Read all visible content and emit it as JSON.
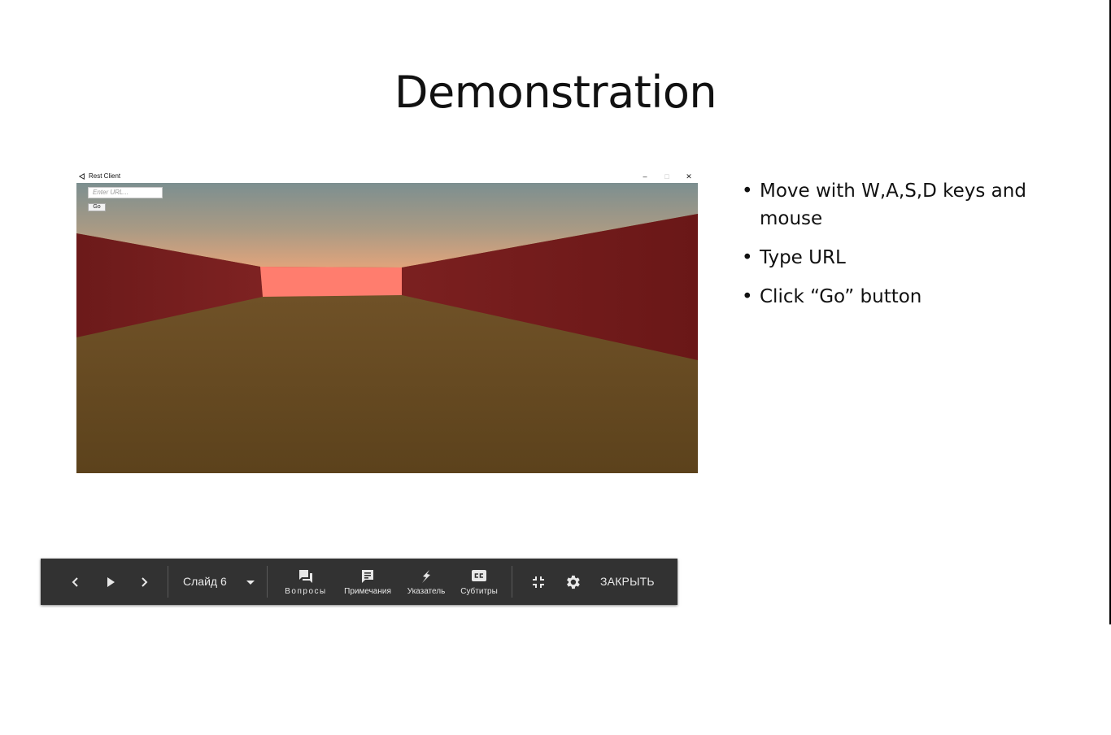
{
  "slide": {
    "title": "Demonstration",
    "bullets": [
      "Move with W,A,S,D keys and mouse",
      "Type URL",
      "Click “Go” button"
    ]
  },
  "embedded_app": {
    "window_title": "Rest Client",
    "url_input_placeholder": "Enter URL...",
    "go_button_label": "Go",
    "window_controls": {
      "minimize": "–",
      "maximize": "□",
      "close": "✕"
    },
    "scene_colors": {
      "sky_top": "#7d9191",
      "sky_horizon": "#d8a880",
      "wall": "#6e1a1a",
      "far_wall": "#ff7a6a",
      "floor": "#6a4b22"
    }
  },
  "toolbar": {
    "prev_icon": "chevron-left-icon",
    "play_icon": "play-icon",
    "next_icon": "chevron-right-icon",
    "slide_label": "Слайд 6",
    "questions_label": "Вопросы",
    "notes_label": "Примечания",
    "pointer_label": "Указатель",
    "captions_label": "Субтитры",
    "close_label": "ЗАКРЫТЬ",
    "background": "#323232"
  }
}
